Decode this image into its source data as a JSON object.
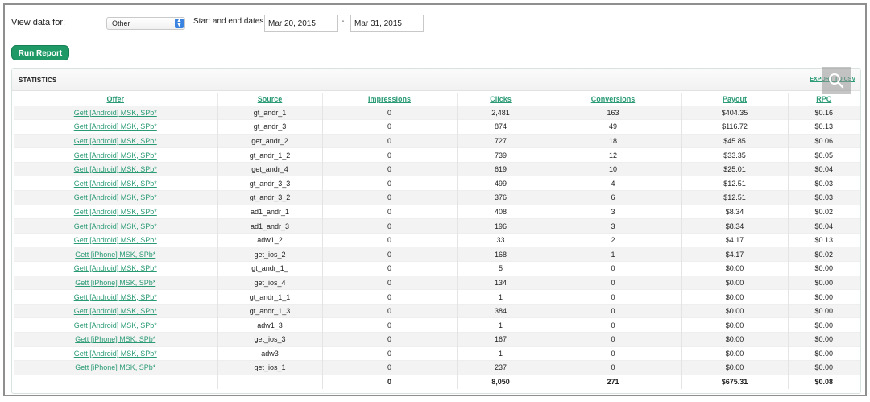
{
  "filters": {
    "view_label": "View data for:",
    "view_value": "Other",
    "dates_label": "Start and end dates:",
    "start_date": "Mar 20, 2015",
    "date_separator": "-",
    "end_date": "Mar 31, 2015",
    "run_button": "Run Report"
  },
  "panel": {
    "title": "STATISTICS",
    "export_label": "EXPORT TO CSV",
    "zoom_icon": "zoom-in-icon"
  },
  "table": {
    "columns": [
      "Offer",
      "Source",
      "Impressions",
      "Clicks",
      "Conversions",
      "Payout",
      "RPC"
    ],
    "rows": [
      [
        "Gett [Android] MSK, SPb*",
        "gt_andr_1",
        "0",
        "2,481",
        "163",
        "$404.35",
        "$0.16"
      ],
      [
        "Gett [Android] MSK, SPb*",
        "gt_andr_3",
        "0",
        "874",
        "49",
        "$116.72",
        "$0.13"
      ],
      [
        "Gett [Android] MSK, SPb*",
        "get_andr_2",
        "0",
        "727",
        "18",
        "$45.85",
        "$0.06"
      ],
      [
        "Gett [Android] MSK, SPb*",
        "gt_andr_1_2",
        "0",
        "739",
        "12",
        "$33.35",
        "$0.05"
      ],
      [
        "Gett [Android] MSK, SPb*",
        "get_andr_4",
        "0",
        "619",
        "10",
        "$25.01",
        "$0.04"
      ],
      [
        "Gett [Android] MSK, SPb*",
        "gt_andr_3_3",
        "0",
        "499",
        "4",
        "$12.51",
        "$0.03"
      ],
      [
        "Gett [Android] MSK, SPb*",
        "gt_andr_3_2",
        "0",
        "376",
        "6",
        "$12.51",
        "$0.03"
      ],
      [
        "Gett [Android] MSK, SPb*",
        "ad1_andr_1",
        "0",
        "408",
        "3",
        "$8.34",
        "$0.02"
      ],
      [
        "Gett [Android] MSK, SPb*",
        "ad1_andr_3",
        "0",
        "196",
        "3",
        "$8.34",
        "$0.04"
      ],
      [
        "Gett [Android] MSK, SPb*",
        "adw1_2",
        "0",
        "33",
        "2",
        "$4.17",
        "$0.13"
      ],
      [
        "Gett [iPhone] MSK, SPb*",
        "get_ios_2",
        "0",
        "168",
        "1",
        "$4.17",
        "$0.02"
      ],
      [
        "Gett [Android] MSK, SPb*",
        "gt_andr_1_",
        "0",
        "5",
        "0",
        "$0.00",
        "$0.00"
      ],
      [
        "Gett [iPhone] MSK, SPb*",
        "get_ios_4",
        "0",
        "134",
        "0",
        "$0.00",
        "$0.00"
      ],
      [
        "Gett [Android] MSK, SPb*",
        "gt_andr_1_1",
        "0",
        "1",
        "0",
        "$0.00",
        "$0.00"
      ],
      [
        "Gett [Android] MSK, SPb*",
        "gt_andr_1_3",
        "0",
        "384",
        "0",
        "$0.00",
        "$0.00"
      ],
      [
        "Gett [Android] MSK, SPb*",
        "adw1_3",
        "0",
        "1",
        "0",
        "$0.00",
        "$0.00"
      ],
      [
        "Gett [iPhone] MSK, SPb*",
        "get_ios_3",
        "0",
        "167",
        "0",
        "$0.00",
        "$0.00"
      ],
      [
        "Gett [Android] MSK, SPb*",
        "adw3",
        "0",
        "1",
        "0",
        "$0.00",
        "$0.00"
      ],
      [
        "Gett [iPhone] MSK, SPb*",
        "get_ios_1",
        "0",
        "237",
        "0",
        "$0.00",
        "$0.00"
      ]
    ],
    "totals": [
      "",
      "",
      "0",
      "8,050",
      "271",
      "$675.31",
      "$0.08"
    ]
  }
}
